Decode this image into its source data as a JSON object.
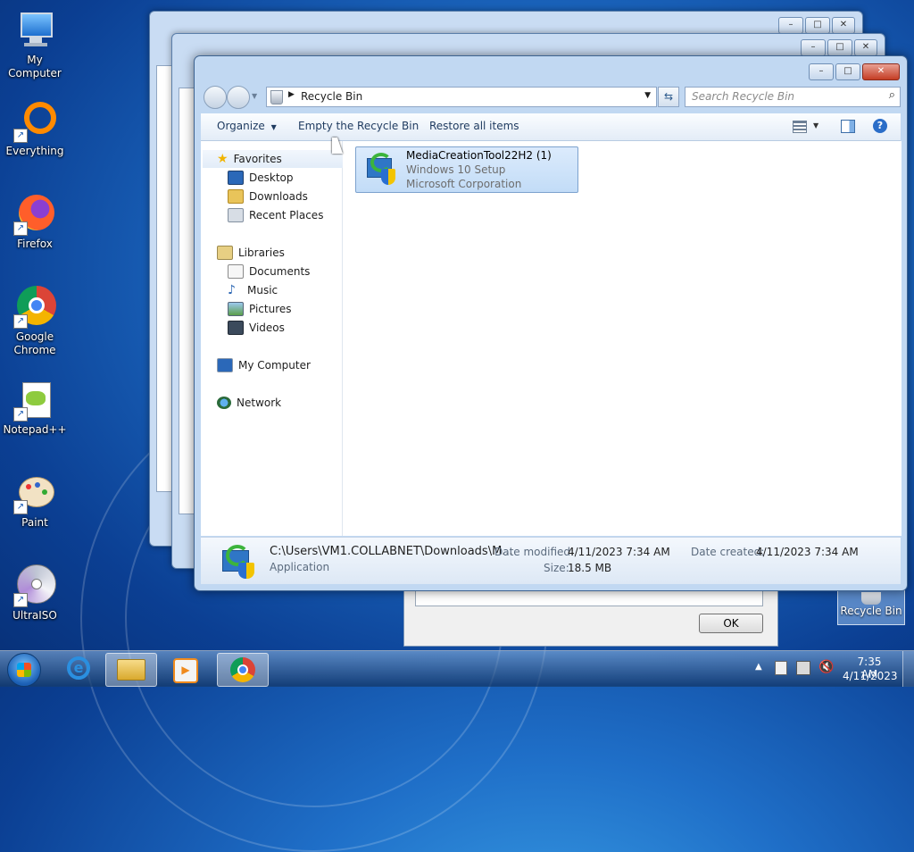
{
  "desktop": {
    "icons": [
      {
        "label": "My Computer"
      },
      {
        "label": "Everything"
      },
      {
        "label": "Firefox"
      },
      {
        "label": "Google Chrome"
      },
      {
        "label": "Notepad++"
      },
      {
        "label": "Paint"
      },
      {
        "label": "UltraISO"
      }
    ],
    "recycle_bin_label": "Recycle Bin"
  },
  "dialog": {
    "ok_label": "OK"
  },
  "explorer": {
    "address_path": "Recycle Bin",
    "search_placeholder": "Search Recycle Bin",
    "toolbar": {
      "organize": "Organize",
      "empty": "Empty the Recycle Bin",
      "restore": "Restore all items"
    },
    "nav": {
      "favorites": "Favorites",
      "desktop": "Desktop",
      "downloads": "Downloads",
      "recent": "Recent Places",
      "libraries": "Libraries",
      "documents": "Documents",
      "music": "Music",
      "pictures": "Pictures",
      "videos": "Videos",
      "computer": "My Computer",
      "network": "Network"
    },
    "item": {
      "name": "MediaCreationTool22H2 (1)",
      "description": "Windows 10 Setup",
      "company": "Microsoft Corporation"
    },
    "details": {
      "path": "C:\\Users\\VM1.COLLABNET\\Downloads\\M...",
      "type": "Application",
      "date_modified_label": "Date modified:",
      "date_modified": "4/11/2023 7:34 AM",
      "size_label": "Size:",
      "size": "18.5 MB",
      "date_created_label": "Date created:",
      "date_created": "4/11/2023 7:34 AM"
    }
  },
  "clock": {
    "time": "7:35 AM",
    "date": "4/11/2023"
  },
  "colors": {
    "accent": "#3399ff",
    "selection": "#cce4fc"
  }
}
